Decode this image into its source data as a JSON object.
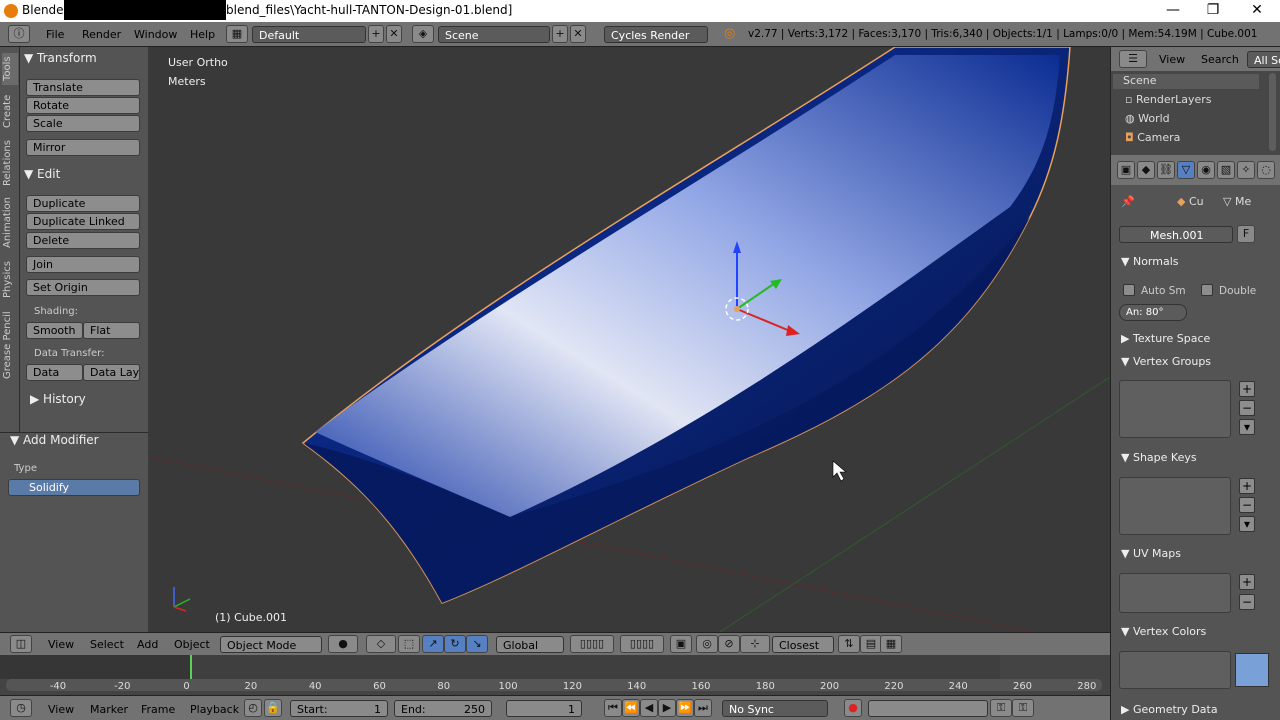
{
  "window": {
    "title_left": "Blender*",
    "title_right": "blend_files\\Yacht-hull-TANTON-Design-01.blend]",
    "min": "—",
    "max": "❐",
    "close": "✕"
  },
  "info": {
    "menus": [
      "File",
      "Render",
      "Window",
      "Help"
    ],
    "layout": "Default",
    "scene": "Scene",
    "engine": "Cycles Render",
    "stats": "v2.77 | Verts:3,172 | Faces:3,170 | Tris:6,340 | Objects:1/1 | Lamps:0/0 | Mem:54.19M | Cube.001"
  },
  "tabs": [
    "Tools",
    "Create",
    "Relations",
    "Animation",
    "Physics",
    "Grease Pencil"
  ],
  "tools": {
    "transform_header": "Transform",
    "translate": "Translate",
    "rotate": "Rotate",
    "scale": "Scale",
    "mirror": "Mirror",
    "edit_header": "Edit",
    "duplicate": "Duplicate",
    "duplicate_linked": "Duplicate Linked",
    "delete": "Delete",
    "join": "Join",
    "set_origin": "Set Origin",
    "shading_label": "Shading:",
    "smooth": "Smooth",
    "flat": "Flat",
    "data_transfer_label": "Data Transfer:",
    "data": "Data",
    "data_layo": "Data Layo",
    "history_header": "History"
  },
  "modifier": {
    "header": "Add Modifier",
    "type_label": "Type",
    "type_value": "Solidify"
  },
  "viewport": {
    "view_name": "User Ortho",
    "units": "Meters",
    "object_label": "(1) Cube.001"
  },
  "view_header": {
    "menus": [
      "View",
      "Select",
      "Add",
      "Object"
    ],
    "mode": "Object Mode",
    "orientation": "Global",
    "snap": "Closest"
  },
  "timeline": {
    "ticks": [
      "-40",
      "-20",
      "0",
      "20",
      "40",
      "60",
      "80",
      "100",
      "120",
      "140",
      "160",
      "180",
      "200",
      "220",
      "240",
      "260",
      "280"
    ],
    "menus": [
      "View",
      "Marker",
      "Frame",
      "Playback"
    ],
    "start_label": "Start:",
    "start_value": "1",
    "end_label": "End:",
    "end_value": "250",
    "current": "1",
    "sync": "No Sync"
  },
  "outliner": {
    "view": "View",
    "search": "Search",
    "filter": "All Sc",
    "items": [
      "Scene",
      "RenderLayers",
      "World",
      "Camera"
    ]
  },
  "properties": {
    "obj_short": "Cu",
    "mesh_short": "Me",
    "mesh_name": "Mesh.001",
    "fake_user": "F",
    "normals": "Normals",
    "auto_smooth": "Auto Sm",
    "double": "Double",
    "angle": "An: 80°",
    "texture_space": "Texture Space",
    "vertex_groups": "Vertex Groups",
    "shape_keys": "Shape Keys",
    "uv_maps": "UV Maps",
    "vertex_colors": "Vertex Colors",
    "geometry_data": "Geometry Data"
  },
  "colors": {
    "hull_blue": "#0a2a8a",
    "outline": "#e8a05a",
    "accent": "#5680c2"
  }
}
